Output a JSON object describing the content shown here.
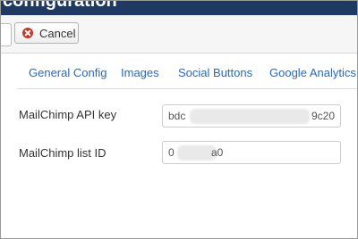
{
  "window": {
    "title": "configuration"
  },
  "toolbar": {
    "cancel_label": "Cancel"
  },
  "tabs": [
    {
      "label": "General Config"
    },
    {
      "label": "Images"
    },
    {
      "label": "Social Buttons"
    },
    {
      "label": "Google Analytics"
    }
  ],
  "fields": {
    "api_key": {
      "label": "MailChimp API key",
      "value_start": "bdc",
      "value_end": "9c20"
    },
    "list_id": {
      "label": "MailChimp list ID",
      "value_start": "0",
      "value_end": "a0"
    }
  },
  "colors": {
    "header_bg": "#1e3a63",
    "tab_link": "#2a69b8",
    "cancel_icon": "#c0392b"
  }
}
